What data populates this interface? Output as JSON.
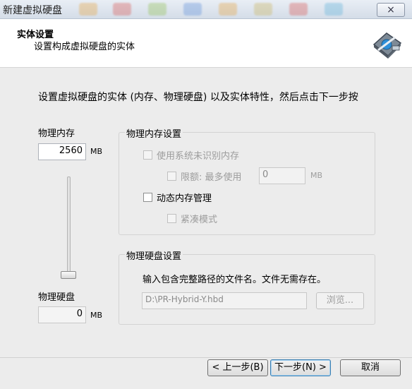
{
  "window": {
    "title": "新建虚拟硬盘",
    "close_icon": "×"
  },
  "header": {
    "title": "实体设置",
    "subtitle": "设置构成虚拟硬盘的实体",
    "icon": "hard-disk-wizard-icon"
  },
  "instruction": "设置虚拟硬盘的实体 (内存、物理硬盘) 以及实体特性，然后点击下一步按",
  "memory": {
    "label": "物理内存",
    "value": "2560",
    "unit": "MB"
  },
  "disk": {
    "label": "物理硬盘",
    "value": "0",
    "unit": "MB"
  },
  "memory_settings": {
    "title": "物理内存设置",
    "use_unrecognized": "使用系统未识别内存",
    "limit_label": "限额: 最多使用",
    "limit_value": "0",
    "limit_unit": "MB",
    "dynamic": "动态内存管理",
    "compact": "紧凑模式"
  },
  "disk_settings": {
    "title": "物理硬盘设置",
    "hint": "输入包含完整路径的文件名。文件无需存在。",
    "path": "D:\\PR-Hybrid-Y.hbd",
    "browse": "浏览..."
  },
  "footer": {
    "back": "< 上一步(B)",
    "next": "下一步(N) >",
    "cancel": "取消"
  }
}
